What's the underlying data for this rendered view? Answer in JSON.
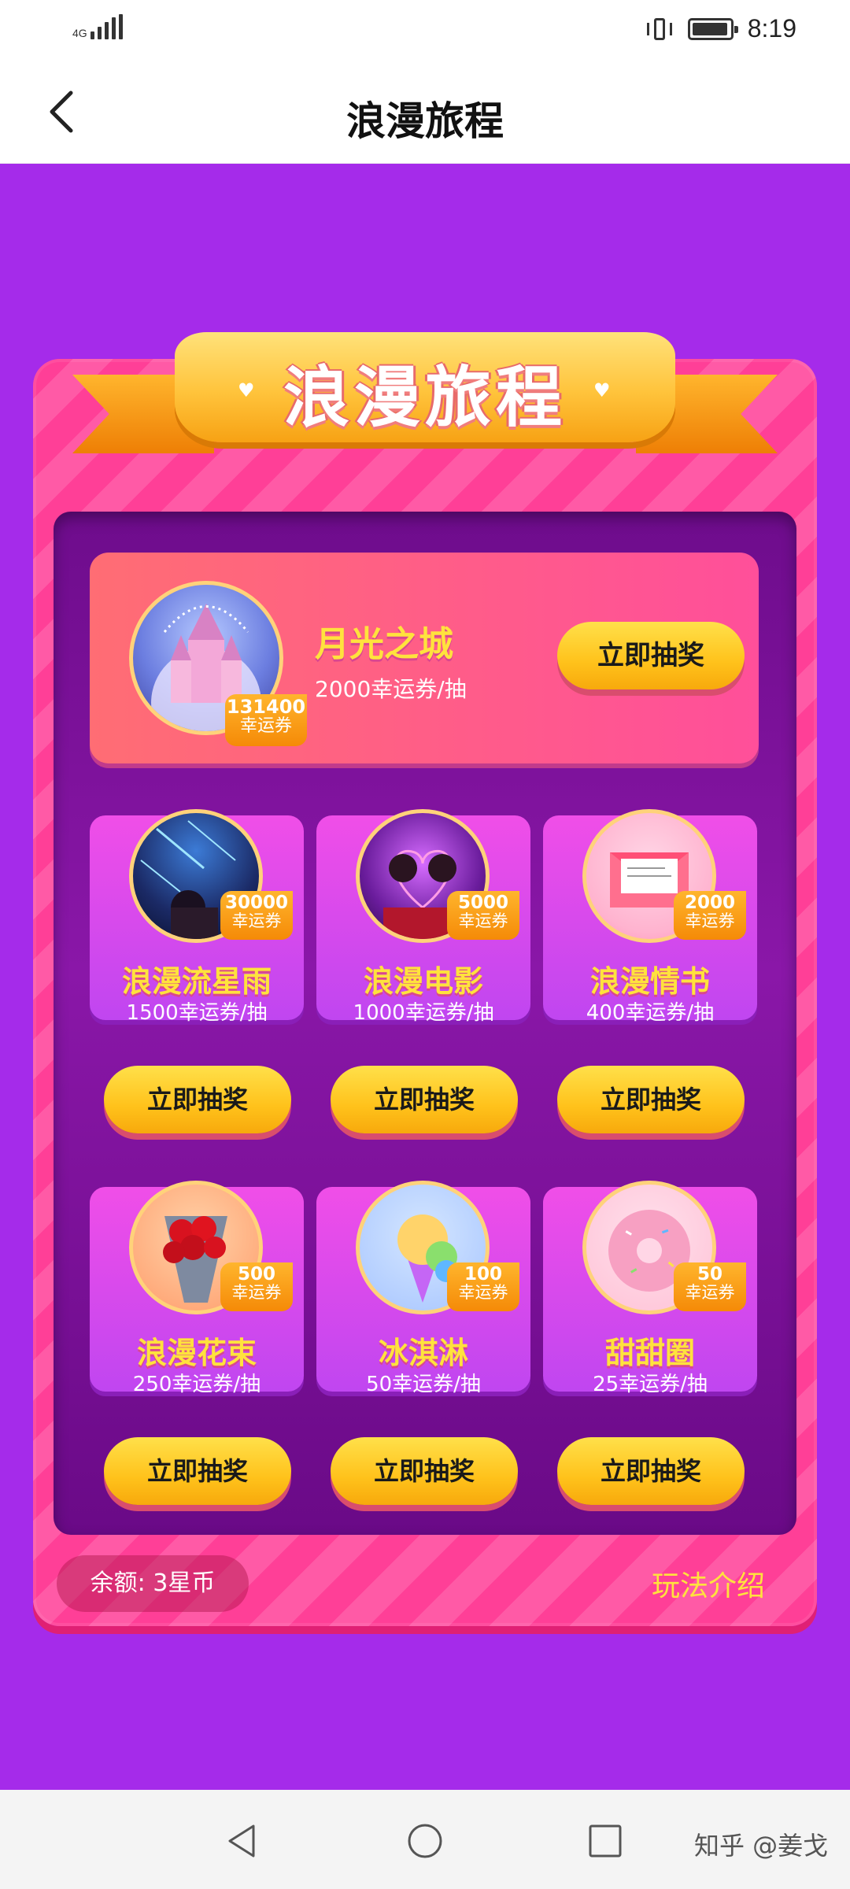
{
  "status_bar": {
    "network": "4G",
    "time": "8:19"
  },
  "header": {
    "title": "浪漫旅程"
  },
  "banner": {
    "title": "浪漫旅程"
  },
  "featured": {
    "name": "月光之城",
    "price": "2000幸运券/抽",
    "badge_value": "131400",
    "badge_unit": "幸运券",
    "button": "立即抽奖"
  },
  "prizes": [
    {
      "name": "浪漫流星雨",
      "price": "1500幸运券/抽",
      "badge_value": "30000",
      "badge_unit": "幸运券",
      "button": "立即抽奖"
    },
    {
      "name": "浪漫电影",
      "price": "1000幸运券/抽",
      "badge_value": "5000",
      "badge_unit": "幸运券",
      "button": "立即抽奖"
    },
    {
      "name": "浪漫情书",
      "price": "400幸运券/抽",
      "badge_value": "2000",
      "badge_unit": "幸运券",
      "button": "立即抽奖"
    },
    {
      "name": "浪漫花束",
      "price": "250幸运券/抽",
      "badge_value": "500",
      "badge_unit": "幸运券",
      "button": "立即抽奖"
    },
    {
      "name": "冰淇淋",
      "price": "50幸运券/抽",
      "badge_value": "100",
      "badge_unit": "幸运券",
      "button": "立即抽奖"
    },
    {
      "name": "甜甜圈",
      "price": "25幸运券/抽",
      "badge_value": "50",
      "badge_unit": "幸运券",
      "button": "立即抽奖"
    }
  ],
  "footer": {
    "balance": "余额: 3星币",
    "rules": "玩法介绍"
  },
  "watermark": "知乎 @姜戈",
  "colors": {
    "background": "#a52bea",
    "board": "#ff3f97",
    "button": "#ffc21b",
    "title_yellow": "#ffe23d"
  }
}
